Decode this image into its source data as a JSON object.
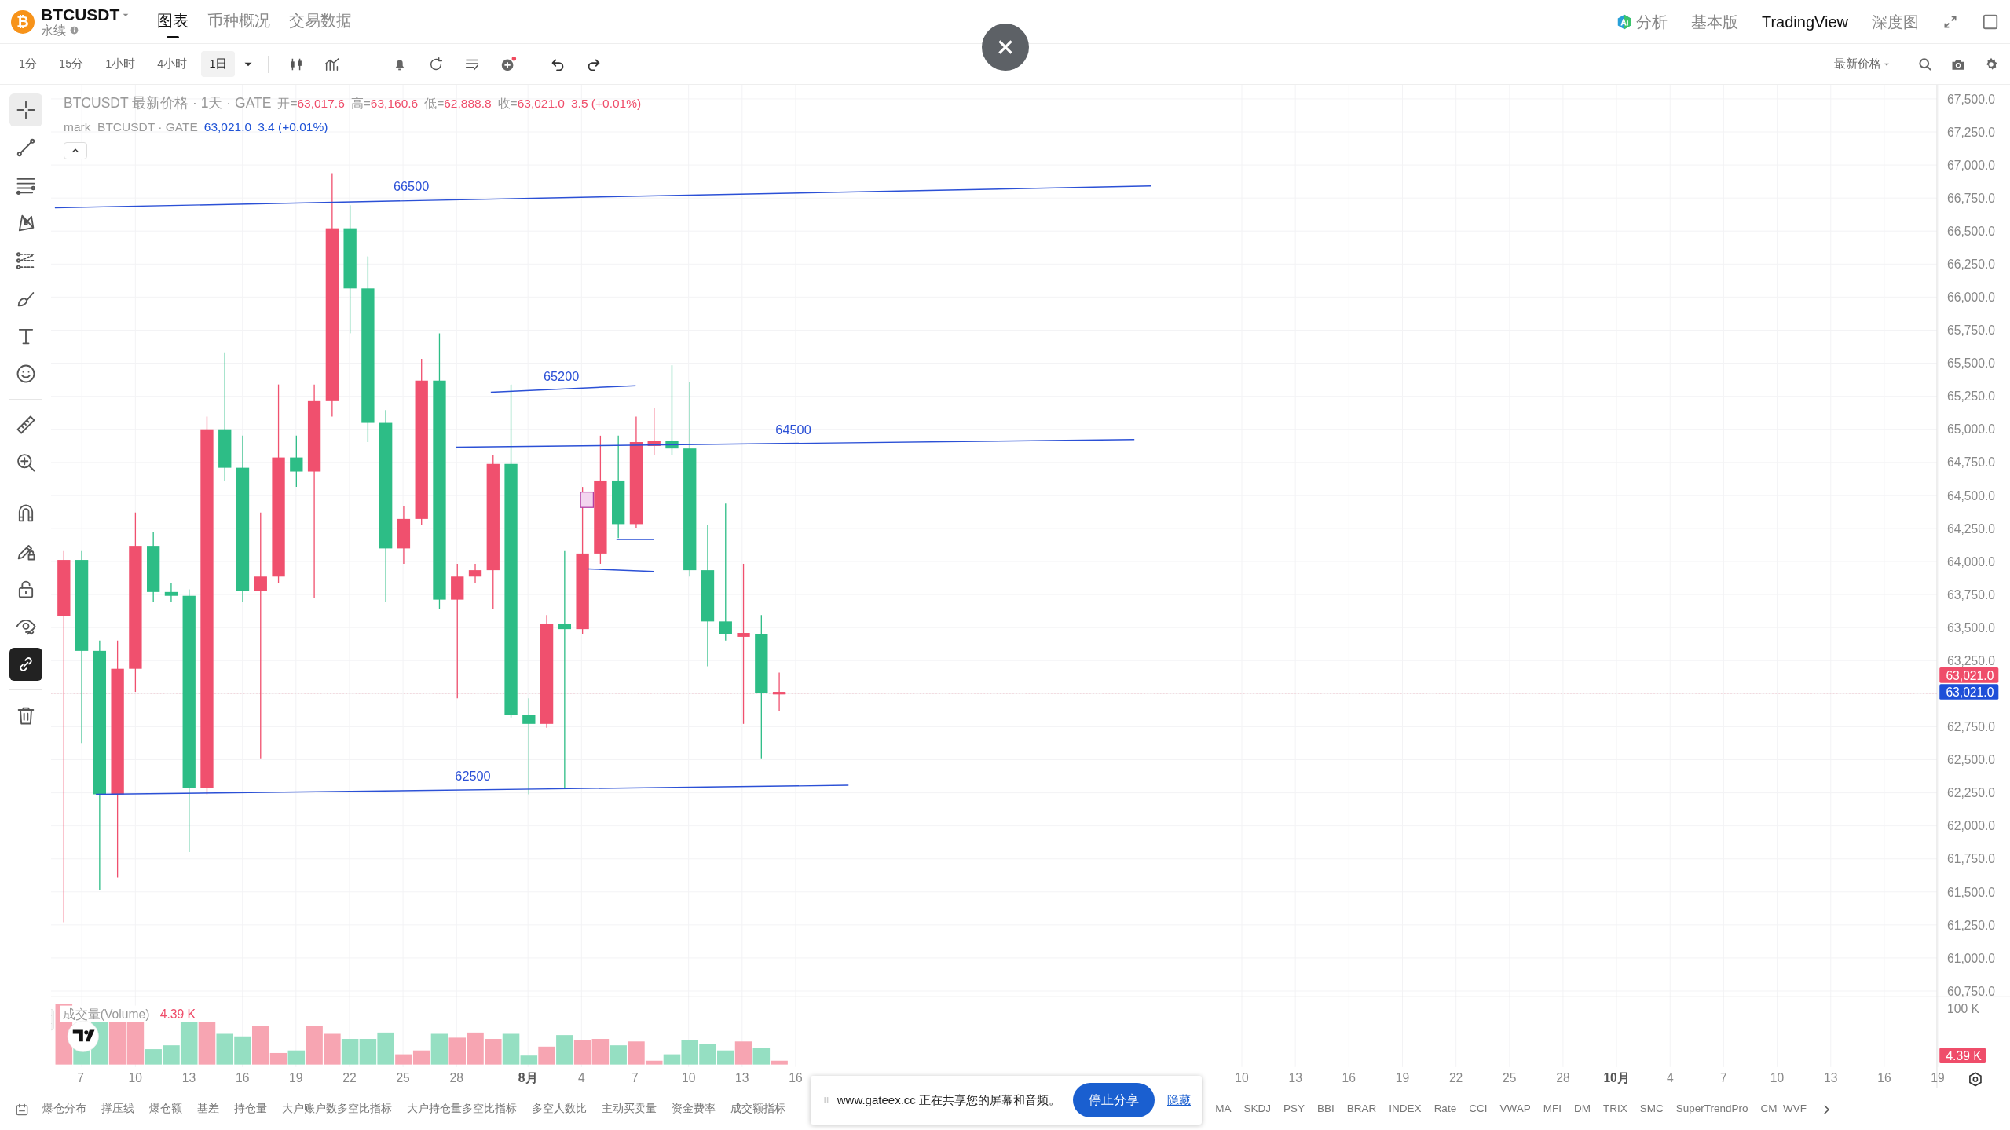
{
  "header": {
    "logo_glyph": "₿",
    "symbol": "BTCUSDT",
    "contract": "永续"
  },
  "view_tabs": [
    {
      "label": "图表",
      "selected": true
    },
    {
      "label": "币种概况",
      "selected": false
    },
    {
      "label": "交易数据",
      "selected": false
    }
  ],
  "right_nav": [
    {
      "label": "分析",
      "selected": false
    },
    {
      "label": "基本版",
      "selected": false
    },
    {
      "label": "TradingView",
      "selected": true
    },
    {
      "label": "深度图",
      "selected": false
    }
  ],
  "intervals": [
    {
      "label": "1分",
      "selected": false
    },
    {
      "label": "15分",
      "selected": false
    },
    {
      "label": "1小时",
      "selected": false
    },
    {
      "label": "4小时",
      "selected": false
    },
    {
      "label": "1日",
      "selected": true
    }
  ],
  "price_source": "最新价格",
  "tools": [
    {
      "selected": true,
      "on": false
    },
    {
      "selected": false,
      "on": false
    },
    {
      "selected": false,
      "on": false
    },
    {
      "selected": false,
      "on": false
    },
    {
      "selected": false,
      "on": false
    },
    {
      "selected": false,
      "on": false
    },
    {
      "selected": false,
      "on": false
    },
    {
      "selected": false,
      "on": false
    },
    {
      "selected": false,
      "on": false
    },
    {
      "selected": false,
      "on": false
    },
    {
      "selected": false,
      "on": false
    },
    {
      "selected": false,
      "on": false
    },
    {
      "selected": false,
      "on": false
    },
    {
      "selected": false,
      "on": false
    },
    {
      "selected": false,
      "on": true
    },
    {
      "selected": false,
      "on": false
    }
  ],
  "legend": {
    "title": "BTCUSDT 最新价格 · 1天 · GATE",
    "ohlc": [
      {
        "label": "开=",
        "value": "63,017.6"
      },
      {
        "label": "高=",
        "value": "63,160.6"
      },
      {
        "label": "低=",
        "value": "62,888.8"
      },
      {
        "label": "收=",
        "value": "63,021.0"
      }
    ],
    "change": "3.5 (+0.01%)",
    "mark_title": "mark_BTCUSDT · GATE",
    "mark_value": "63,021.0",
    "mark_change": "3.4 (+0.01%)"
  },
  "trend_lines": [
    {
      "label": "66500"
    },
    {
      "label": "65200"
    },
    {
      "label": "64500"
    },
    {
      "label": "62500"
    }
  ],
  "price_axis": [
    "67,500.0",
    "67,250.0",
    "67,000.0",
    "66,750.0",
    "66,500.0",
    "66,250.0",
    "66,000.0",
    "65,750.0",
    "65,500.0",
    "65,250.0",
    "65,000.0",
    "64,750.0",
    "64,500.0",
    "64,250.0",
    "64,000.0",
    "63,750.0",
    "63,500.0",
    "63,250.0",
    "63,021.0",
    "63,021.0",
    "62,750.0",
    "62,500.0",
    "62,250.0",
    "62,000.0",
    "61,750.0",
    "61,500.0",
    "61,250.0",
    "61,000.0",
    "60,750.0"
  ],
  "volume": {
    "title": "成交量(Volume)",
    "value": "4.39 K",
    "axis_label": "100 K",
    "tag": "4.39 K"
  },
  "date_axis": [
    {
      "label": "7",
      "kind": "day"
    },
    {
      "label": "10",
      "kind": "day"
    },
    {
      "label": "13",
      "kind": "day"
    },
    {
      "label": "16",
      "kind": "day"
    },
    {
      "label": "19",
      "kind": "day"
    },
    {
      "label": "22",
      "kind": "day"
    },
    {
      "label": "25",
      "kind": "day"
    },
    {
      "label": "28",
      "kind": "day"
    },
    {
      "label": "8月",
      "kind": "month"
    },
    {
      "label": "4",
      "kind": "day"
    },
    {
      "label": "7",
      "kind": "day"
    },
    {
      "label": "10",
      "kind": "day"
    },
    {
      "label": "13",
      "kind": "day"
    },
    {
      "label": "16",
      "kind": "day"
    },
    {
      "label": "10",
      "kind": "day"
    },
    {
      "label": "13",
      "kind": "day"
    },
    {
      "label": "16",
      "kind": "day"
    },
    {
      "label": "19",
      "kind": "day"
    },
    {
      "label": "22",
      "kind": "day"
    },
    {
      "label": "25",
      "kind": "day"
    },
    {
      "label": "28",
      "kind": "day"
    },
    {
      "label": "10月",
      "kind": "month"
    },
    {
      "label": "4",
      "kind": "day"
    },
    {
      "label": "7",
      "kind": "day"
    },
    {
      "label": "10",
      "kind": "day"
    },
    {
      "label": "13",
      "kind": "day"
    },
    {
      "label": "16",
      "kind": "day"
    },
    {
      "label": "19",
      "kind": "day"
    }
  ],
  "indicator_tabs_left": [
    "爆仓分布",
    "撑压线",
    "爆仓额",
    "基差",
    "持仓量",
    "大户账户数多空比指标",
    "大户持仓量多空比指标",
    "多空人数比",
    "主动买卖量",
    "资金费率",
    "成交额指标"
  ],
  "indicator_tabs_right": [
    "MA",
    "SKDJ",
    "PSY",
    "BBI",
    "BRAR",
    "INDEX",
    "Rate",
    "CCI",
    "VWAP",
    "MFI",
    "DM",
    "TRIX",
    "SMC",
    "SuperTrendPro",
    "CM_WVF"
  ],
  "share_bar": {
    "message": "www.gateex.cc 正在共享您的屏幕和音频。",
    "stop_button": "停止分享",
    "hide_link": "隐藏"
  }
}
